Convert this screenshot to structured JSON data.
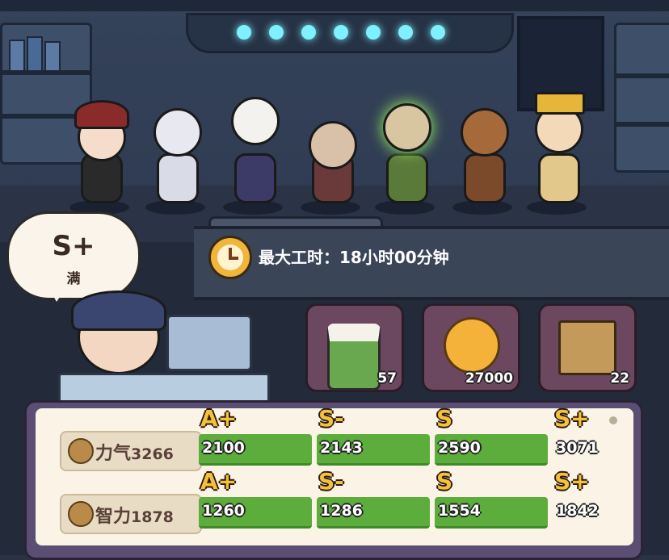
{
  "bubble": {
    "grade": "S+",
    "status": "满"
  },
  "banner": {
    "worktime": "最大工时：18小时00分钟",
    "icon": "clock-icon"
  },
  "resources": [
    {
      "icon": "rice-cake-icon",
      "count": "57"
    },
    {
      "icon": "gold-coin-icon",
      "count": "27000"
    },
    {
      "icon": "paper-bag-icon",
      "count": "22"
    }
  ],
  "stats": [
    {
      "icon": "muscle-icon",
      "name": "力气",
      "value": "3266",
      "tiers": [
        {
          "grade": "A+",
          "value": "2100"
        },
        {
          "grade": "S-",
          "value": "2143"
        },
        {
          "grade": "S",
          "value": "2590"
        },
        {
          "grade": "S+",
          "value": "3071"
        }
      ]
    },
    {
      "icon": "brain-icon",
      "name": "智力",
      "value": "1878",
      "tiers": [
        {
          "grade": "A+",
          "value": "1260"
        },
        {
          "grade": "S-",
          "value": "1286"
        },
        {
          "grade": "S",
          "value": "1554"
        },
        {
          "grade": "S+",
          "value": "1842"
        }
      ]
    }
  ],
  "colors": {
    "grade_gold": "#f4c13a",
    "bar_green": "#5cad3c",
    "accent_purple": "#5a4f72"
  }
}
